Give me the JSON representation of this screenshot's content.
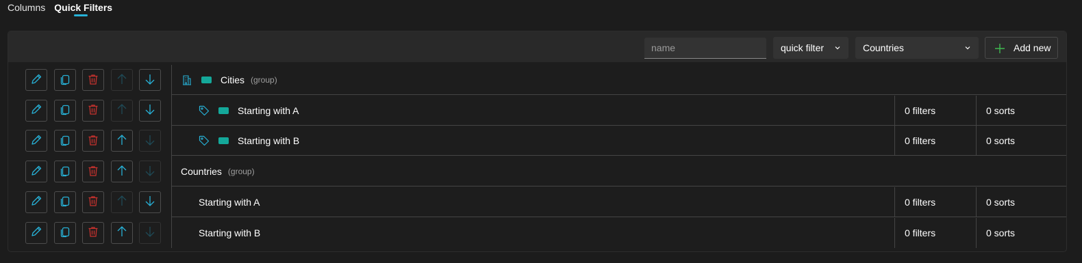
{
  "tabs": [
    {
      "label": "Columns",
      "active": false
    },
    {
      "label": "Quick Filters",
      "active": true
    }
  ],
  "toolbar": {
    "name_placeholder": "name",
    "name_value": "",
    "type_select": "quick filter",
    "entity_select": "Countries",
    "add_label": "Add new"
  },
  "colors": {
    "accent": "#27b2d8",
    "delete": "#c8322e",
    "swatch": "#14a89a",
    "add_plus": "#3fb950"
  },
  "rows": [
    {
      "name": "Cities",
      "group_tag": "(group)",
      "icon": "building-icon",
      "swatch": true,
      "filters": "",
      "sorts": "",
      "up_enabled": false,
      "down_enabled": true
    },
    {
      "name": "Starting with A",
      "group_tag": "",
      "icon": "tag-icon",
      "swatch": true,
      "filters": "0 filters",
      "sorts": "0 sorts",
      "up_enabled": false,
      "down_enabled": true
    },
    {
      "name": "Starting with B",
      "group_tag": "",
      "icon": "tag-icon",
      "swatch": true,
      "filters": "0 filters",
      "sorts": "0 sorts",
      "up_enabled": true,
      "down_enabled": false
    },
    {
      "name": "Countries",
      "group_tag": "(group)",
      "icon": "",
      "swatch": false,
      "filters": "",
      "sorts": "",
      "up_enabled": true,
      "down_enabled": false
    },
    {
      "name": "Starting with A",
      "group_tag": "",
      "icon": "",
      "swatch": false,
      "filters": "0 filters",
      "sorts": "0 sorts",
      "up_enabled": false,
      "down_enabled": true
    },
    {
      "name": "Starting with B",
      "group_tag": "",
      "icon": "",
      "swatch": false,
      "filters": "0 filters",
      "sorts": "0 sorts",
      "up_enabled": true,
      "down_enabled": false
    }
  ]
}
